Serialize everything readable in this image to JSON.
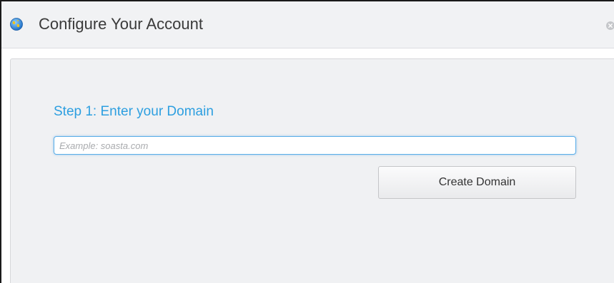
{
  "dialog": {
    "title": "Configure Your Account",
    "icon": "globe-icon",
    "close_icon": "close-icon"
  },
  "step": {
    "heading": "Step 1: Enter your Domain",
    "domain_input": {
      "value": "",
      "placeholder": "Example: soasta.com"
    },
    "create_button_label": "Create Domain"
  },
  "colors": {
    "heading_accent": "#2d9fe0",
    "input_focus_border": "#5aaee8",
    "header_bg": "#f1f2f4",
    "panel_bg": "#f0f1f3"
  }
}
